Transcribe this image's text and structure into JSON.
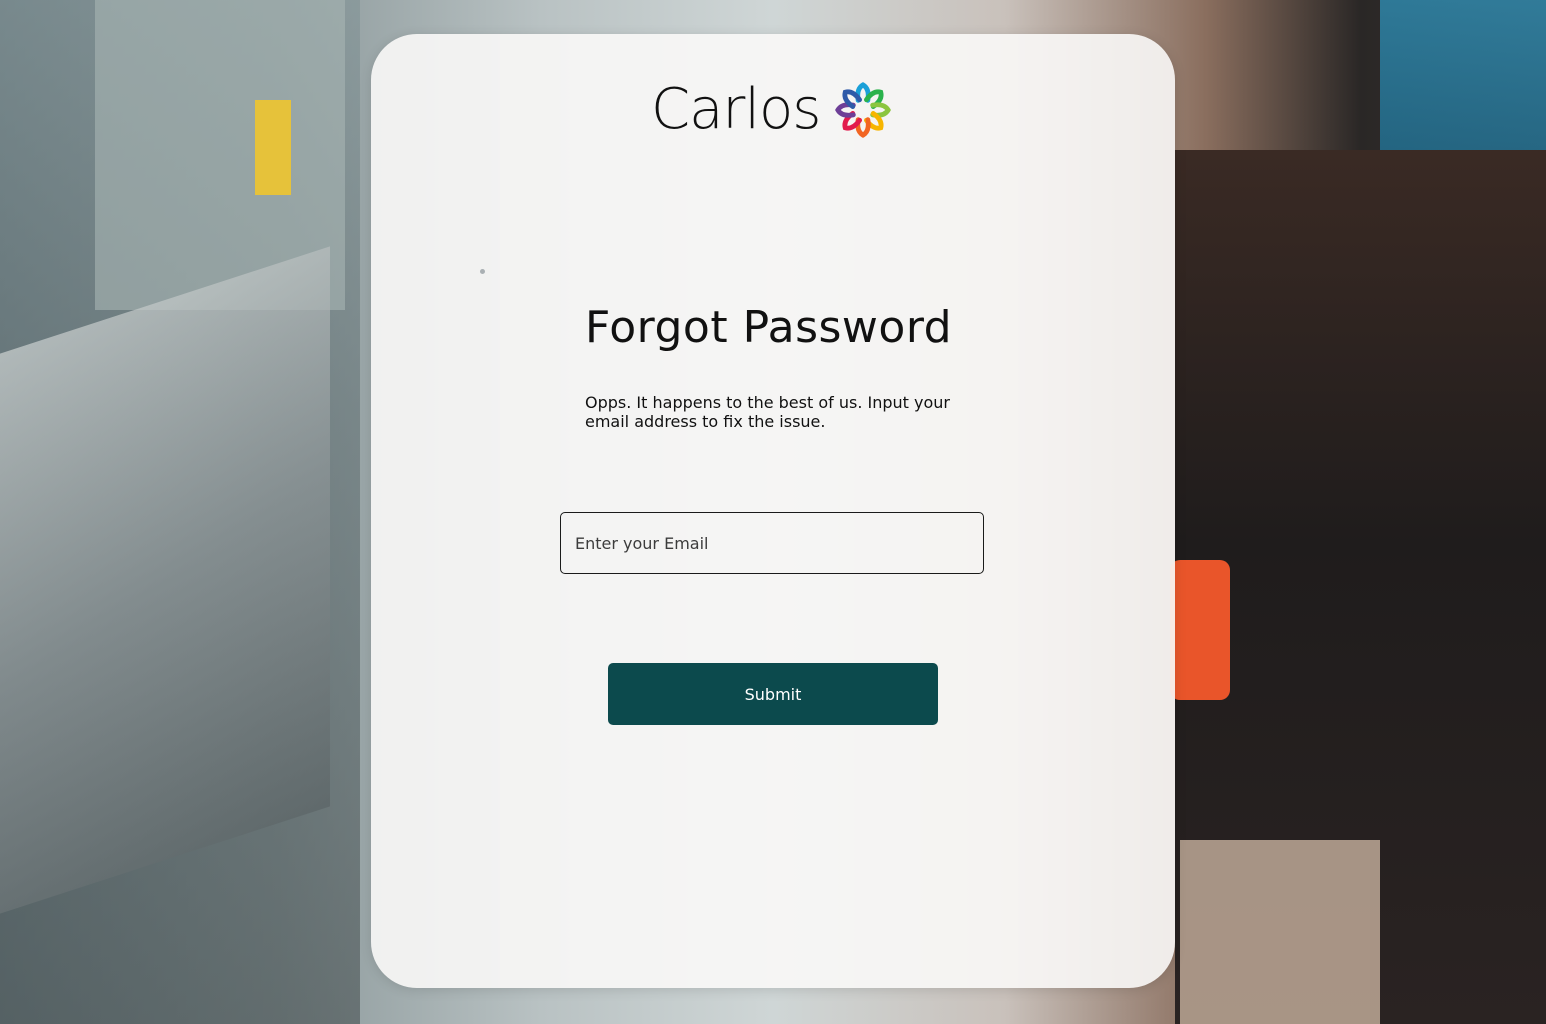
{
  "brand": {
    "name": "Carlos",
    "logo_icon": "flower-icon",
    "logo_colors": [
      "#1aa0d8",
      "#2bb24c",
      "#8bc53f",
      "#f7b500",
      "#f26522",
      "#e21b4d",
      "#6d3f97",
      "#2e5aa8"
    ]
  },
  "form": {
    "title": "Forgot Password",
    "description": "Opps. It happens to the best of us. Input your email address to fix the issue.",
    "email_placeholder": "Enter your Email",
    "email_value": "",
    "submit_label": "Submit"
  },
  "colors": {
    "accent": "#0c4a4d",
    "card_background": "#faf8f7"
  }
}
